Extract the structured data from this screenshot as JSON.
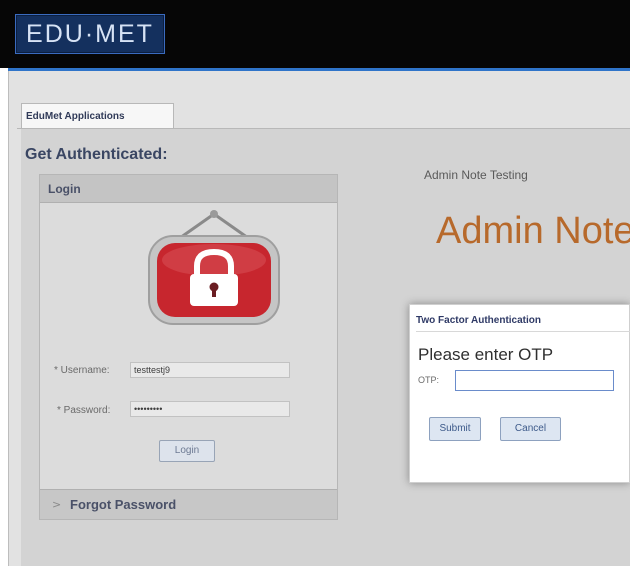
{
  "header": {
    "logo_text": "EDU·MET"
  },
  "tabs": [
    {
      "label": "EduMet Applications"
    }
  ],
  "page": {
    "heading": "Get Authenticated:"
  },
  "login": {
    "panel_title": "Login",
    "username_label": "* Username:",
    "username_value": "testtestj9",
    "password_label": "* Password:",
    "password_value": "•••••••••",
    "login_button": "Login",
    "forgot_password": "Forgot Password",
    "forgot_chevron": ">"
  },
  "admin_note": {
    "small_text": "Admin Note Testing",
    "big_text": "Admin Note"
  },
  "otp_dialog": {
    "title": "Two Factor Authentication",
    "prompt": "Please enter OTP",
    "otp_label": "OTP:",
    "otp_value": "",
    "submit_button": "Submit",
    "cancel_button": "Cancel"
  },
  "icons": {
    "lock": "lock-icon",
    "chevron": "chevron-right-icon"
  },
  "colors": {
    "header_bg": "#060606",
    "accent_blue": "#2f74c9",
    "admin_note": "#b7692b",
    "lock_red": "#c7262e"
  }
}
